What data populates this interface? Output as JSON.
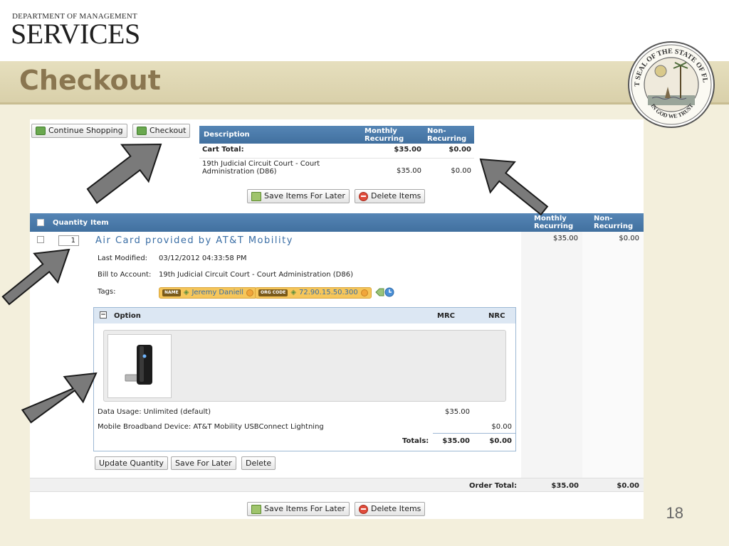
{
  "slide": {
    "logo_dept": "DEPARTMENT OF MANAGEMENT",
    "logo_services": "SERVICES",
    "title": "Checkout",
    "page_number": "18",
    "seal": {
      "top_text": "GREAT SEAL OF THE STATE OF FLORIDA",
      "motto": "IN GOD WE TRUST"
    }
  },
  "toolbar": {
    "continue_shopping": "Continue Shopping",
    "checkout": "Checkout"
  },
  "summary": {
    "headers": {
      "description": "Description",
      "monthly": "Monthly Recurring",
      "nonrecurring": "Non-Recurring"
    },
    "cart_total_label": "Cart Total:",
    "cart_total_monthly": "$35.00",
    "cart_total_nonrecurring": "$0.00",
    "account_line1": "19th Judicial Circuit Court - Court",
    "account_line2": "Administration (D86)",
    "account_monthly": "$35.00",
    "account_nonrecurring": "$0.00",
    "save_items_later": "Save Items For Later",
    "delete_items": "Delete Items"
  },
  "grid": {
    "headers": {
      "quantity": "Quantity",
      "item": "Item",
      "monthly": "Monthly Recurring",
      "nonrecurring": "Non-Recurring"
    },
    "item": {
      "quantity": "1",
      "title": "Air Card provided by AT&T Mobility",
      "monthly": "$35.00",
      "nonrecurring": "$0.00",
      "last_modified_label": "Last Modified:",
      "last_modified_value": "03/12/2012 04:33:58 PM",
      "bill_to_label": "Bill to Account:",
      "bill_to_value": "19th Judicial Circuit Court - Court Administration (D86)",
      "tags_label": "Tags:",
      "tags": [
        {
          "key": "NAME",
          "value": "Jeremy Daniell"
        },
        {
          "key": "ORG CODE",
          "value": "72.90.15.50.300"
        }
      ]
    },
    "option": {
      "header": "Option",
      "mrc": "MRC",
      "nrc": "NRC",
      "lines": [
        {
          "label": "Data Usage: Unlimited (default)",
          "mrc": "$35.00",
          "nrc": ""
        },
        {
          "label": "Mobile Broadband Device: AT&T Mobility USBConnect Lightning",
          "mrc": "",
          "nrc": "$0.00"
        }
      ],
      "totals_label": "Totals:",
      "totals_mrc": "$35.00",
      "totals_nrc": "$0.00"
    },
    "item_buttons": {
      "update_quantity": "Update Quantity",
      "save_for_later": "Save For Later",
      "delete": "Delete"
    },
    "order_total_label": "Order Total:",
    "order_total_monthly": "$35.00",
    "order_total_nonrecurring": "$0.00",
    "bottom_save_items_later": "Save Items For Later",
    "bottom_delete_items": "Delete Items"
  },
  "colors": {
    "header_blue": "#4a79a9",
    "title_brown": "#8a7650",
    "tag_yellow": "#f6c65a",
    "arrow_gray": "#7a7a7a"
  }
}
